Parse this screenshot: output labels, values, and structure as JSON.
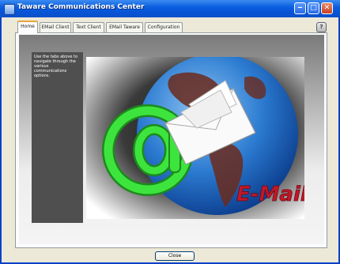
{
  "window": {
    "title": "Taware Communications Center"
  },
  "titlebar_buttons": {
    "minimize": "‒",
    "maximize": "□",
    "close": "✕"
  },
  "tabs": [
    {
      "label": "Home",
      "active": true
    },
    {
      "label": "EMail Client",
      "active": false
    },
    {
      "label": "Text Client",
      "active": false
    },
    {
      "label": "EMail Taware",
      "active": false
    },
    {
      "label": "Configuration",
      "active": false
    }
  ],
  "help": {
    "label": "?"
  },
  "sidebar": {
    "text": "Use the tabs above to navigate through the various communications options."
  },
  "image": {
    "text": "E-Mail",
    "text_color": "#c0182a",
    "globe_color": "#2a7ad0",
    "at_color": "#2ecc2e"
  },
  "footer": {
    "close_label": "Close"
  }
}
